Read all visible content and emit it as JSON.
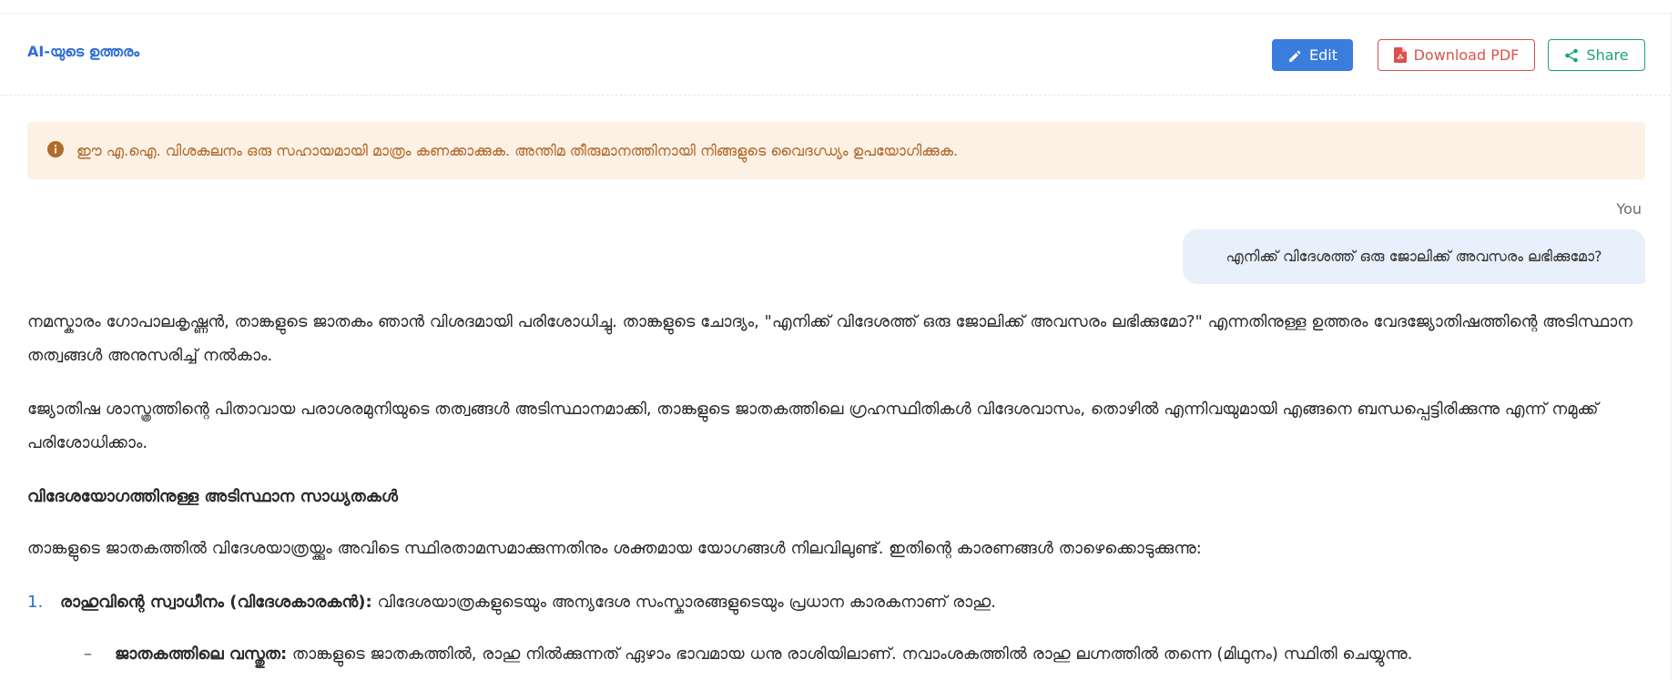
{
  "header": {
    "title": "AI-യുടെ ഉത്തരം",
    "edit_label": "Edit",
    "download_label": "Download PDF",
    "share_label": "Share"
  },
  "alert": {
    "text": "ഈ എ.ഐ. വിശകലനം ഒരു സഹായമായി മാത്രം കണക്കാക്കുക. അന്തിമ തീരുമാനത്തിനായി നിങ്ങളുടെ വൈദഗ്ധ്യം ഉപയോഗിക്കുക."
  },
  "question": {
    "sender": "You",
    "text": "എനിക്ക് വിദേശത്ത് ഒരു ജോലിക്ക് അവസരം ലഭിക്കുമോ?"
  },
  "answer": {
    "para1": "നമസ്കാരം ഗോപാലകൃഷ്ണൻ, താങ്കളുടെ ജാതകം ഞാൻ വിശദമായി പരിശോധിച്ചു. താങ്കളുടെ ചോദ്യം, \"എനിക്ക് വിദേശത്ത് ഒരു ജോലിക്ക് അവസരം ലഭിക്കുമോ?\" എന്നതിനുള്ള ഉത്തരം വേദജ്യോതിഷത്തിന്റെ അടിസ്ഥാന തത്വങ്ങൾ അനുസരിച്ച് നൽകാം.",
    "para2": "ജ്യോതിഷ ശാസ്ത്രത്തിന്റെ പിതാവായ പരാശരമുനിയുടെ തത്വങ്ങൾ അടിസ്ഥാനമാക്കി, താങ്കളുടെ ജാതകത്തിലെ ഗ്രഹസ്ഥിതികൾ വിദേശവാസം, തൊഴിൽ എന്നിവയുമായി എങ്ങനെ ബന്ധപ്പെട്ടിരിക്കുന്നു എന്ന് നമുക്ക് പരിശോധിക്കാം.",
    "heading": "വിദേശയോഗത്തിനുള്ള അടിസ്ഥാന സാധ്യതകൾ",
    "para3": "താങ്കളുടെ ജാതകത്തിൽ വിദേശയാത്രയ്ക്കും അവിടെ സ്ഥിരതാമസമാക്കുന്നതിനും ശക്തമായ യോഗങ്ങൾ നിലവിലുണ്ട്. ഇതിന്റെ കാരണങ്ങൾ താഴെക്കൊടുക്കുന്നു:",
    "item1_num": "1.",
    "item1_bold": "രാഹുവിന്റെ സ്വാധീനം (വിദേശകാരകൻ):",
    "item1_text": " വിദേശയാത്രകളുടെയും അന്യദേശ സംസ്കാരങ്ങളുടെയും പ്രധാന കാരകനാണ് രാഹു.",
    "sub1_dash": "–",
    "sub1_bold": "ജാതകത്തിലെ വസ്തുത:",
    "sub1_text": " താങ്കളുടെ ജാതകത്തിൽ, രാഹു നിൽക്കുന്നത് ഏഴാം ഭാവമായ ധനു രാശിയിലാണ്. നവാംശകത്തിൽ രാഹു ലഗ്നത്തിൽ തന്നെ (മിഥുനം) സ്ഥിതി ചെയ്യുന്നു."
  },
  "colors": {
    "accent": "#3b7ddd",
    "danger": "#d9534f",
    "success": "#1aa37a",
    "warning_bg": "#fdf1e6",
    "warning_text": "#b06a2a"
  }
}
